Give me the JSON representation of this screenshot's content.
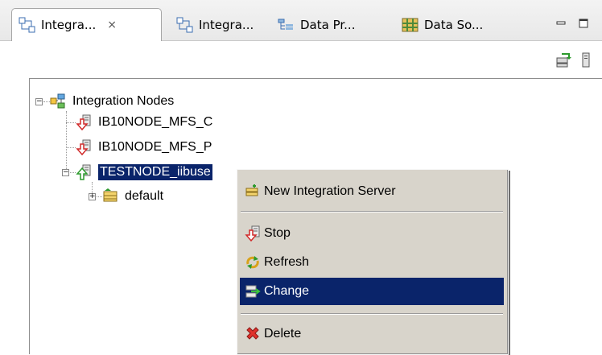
{
  "tabs": [
    {
      "label": "Integra...",
      "icon": "integration-nodes-icon",
      "active": true,
      "closable": true
    },
    {
      "label": "Integra...",
      "icon": "integration-nodes-icon",
      "active": false
    },
    {
      "label": "Data Pr...",
      "icon": "data-project-icon",
      "active": false
    },
    {
      "label": "Data So...",
      "icon": "data-source-icon",
      "active": false
    }
  ],
  "tree": {
    "root": {
      "label": "Integration Nodes",
      "icon": "integration-nodes-icon",
      "expanded": true
    },
    "nodes": [
      {
        "label": "IB10NODE_MFS_C",
        "icon": "node-stopped-icon",
        "status": "stopped"
      },
      {
        "label": "IB10NODE_MFS_P",
        "icon": "node-stopped-icon",
        "status": "stopped"
      },
      {
        "label": "TESTNODE_iibuse",
        "icon": "node-running-icon",
        "status": "running",
        "selected": true,
        "expanded": true
      }
    ],
    "child": {
      "label": "default",
      "icon": "integration-server-icon",
      "expanded": false
    }
  },
  "context_menu": {
    "items": [
      {
        "label": "New Integration Server",
        "icon": "new-server-icon"
      },
      {
        "label": "Stop",
        "icon": "stop-icon"
      },
      {
        "label": "Refresh",
        "icon": "refresh-icon"
      },
      {
        "label": "Change",
        "icon": "change-icon",
        "highlighted": true
      },
      {
        "label": "Delete",
        "icon": "delete-icon"
      }
    ]
  },
  "colors": {
    "selection": "#0a246a",
    "menu_bg": "#d8d4cb",
    "stopped": "#d12a2a",
    "running": "#2c9a2c"
  }
}
